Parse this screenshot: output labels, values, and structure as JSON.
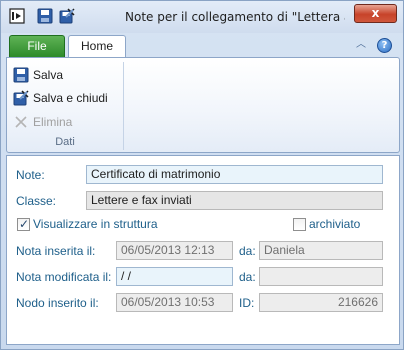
{
  "window": {
    "title": "Note per il collegamento di \"Lettera a c...",
    "close_label": "x"
  },
  "quick_access": {
    "icons": [
      "window-menu-icon",
      "save-icon",
      "save-and-close-icon"
    ]
  },
  "tabs": {
    "file_label": "File",
    "home_label": "Home"
  },
  "ribbon": {
    "save_label": "Salva",
    "save_close_label": "Salva e chiudi",
    "delete_label": "Elimina",
    "group_label": "Dati"
  },
  "form": {
    "note_label": "Note:",
    "note_value": "Certificato di matrimonio",
    "class_label": "Classe:",
    "class_value": "Lettere e fax inviati",
    "show_tree_label": "Visualizzare in struttura",
    "show_tree_checked": true,
    "archived_label": "archiviato",
    "archived_checked": false,
    "inserted_label": "Nota inserita il:",
    "inserted_value": "06/05/2013 12:13",
    "inserted_by_label": "da:",
    "inserted_by_value": "Daniela",
    "modified_label": "Nota modificata il:",
    "modified_value": " /  /",
    "modified_by_label": "da:",
    "modified_by_value": "",
    "node_label": "Nodo inserito il:",
    "node_value": "06/05/2013 10:53",
    "id_label": "ID:",
    "id_value": "216626"
  }
}
